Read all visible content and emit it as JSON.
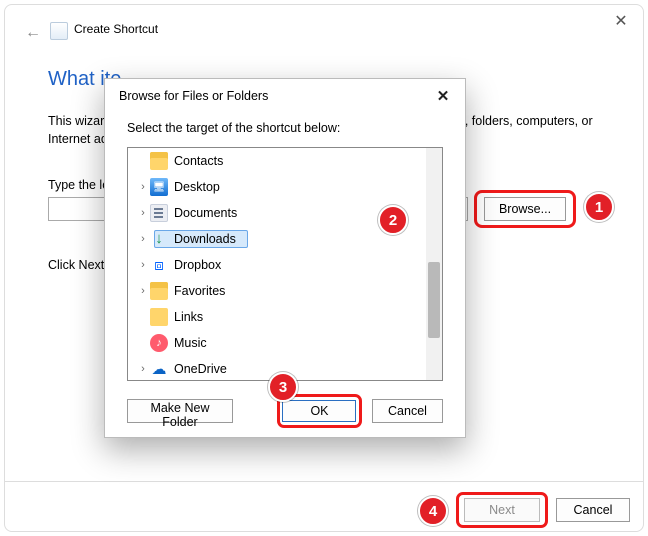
{
  "window": {
    "back_icon": "←",
    "close_icon": "✕",
    "title": "Create Shortcut"
  },
  "wizard": {
    "heading_visible": "What ite",
    "description": "This wizard helps you to create shortcuts to local or network programs, files, folders, computers, or Internet addresses.",
    "type_label_visible": "Type the lo",
    "browse_label": "Browse...",
    "click_next_visible": "Click Next",
    "next_label": "Next",
    "cancel_label": "Cancel"
  },
  "modal": {
    "title": "Browse for Files or Folders",
    "close_icon": "✕",
    "instruction": "Select the target of the shortcut below:",
    "make_new_folder_label": "Make New Folder",
    "ok_label": "OK",
    "cancel_label": "Cancel",
    "items": [
      {
        "label": "Contacts",
        "expandable": false,
        "selected": false,
        "icon": "folder"
      },
      {
        "label": "Desktop",
        "expandable": true,
        "selected": false,
        "icon": "desktop"
      },
      {
        "label": "Documents",
        "expandable": true,
        "selected": false,
        "icon": "docs"
      },
      {
        "label": "Downloads",
        "expandable": true,
        "selected": true,
        "icon": "download"
      },
      {
        "label": "Dropbox",
        "expandable": true,
        "selected": false,
        "icon": "dropbox"
      },
      {
        "label": "Favorites",
        "expandable": true,
        "selected": false,
        "icon": "folder"
      },
      {
        "label": "Links",
        "expandable": false,
        "selected": false,
        "icon": "folder"
      },
      {
        "label": "Music",
        "expandable": false,
        "selected": false,
        "icon": "music"
      },
      {
        "label": "OneDrive",
        "expandable": true,
        "selected": false,
        "icon": "onedrive"
      }
    ]
  },
  "badges": {
    "b1": "1",
    "b2": "2",
    "b3": "3",
    "b4": "4"
  }
}
